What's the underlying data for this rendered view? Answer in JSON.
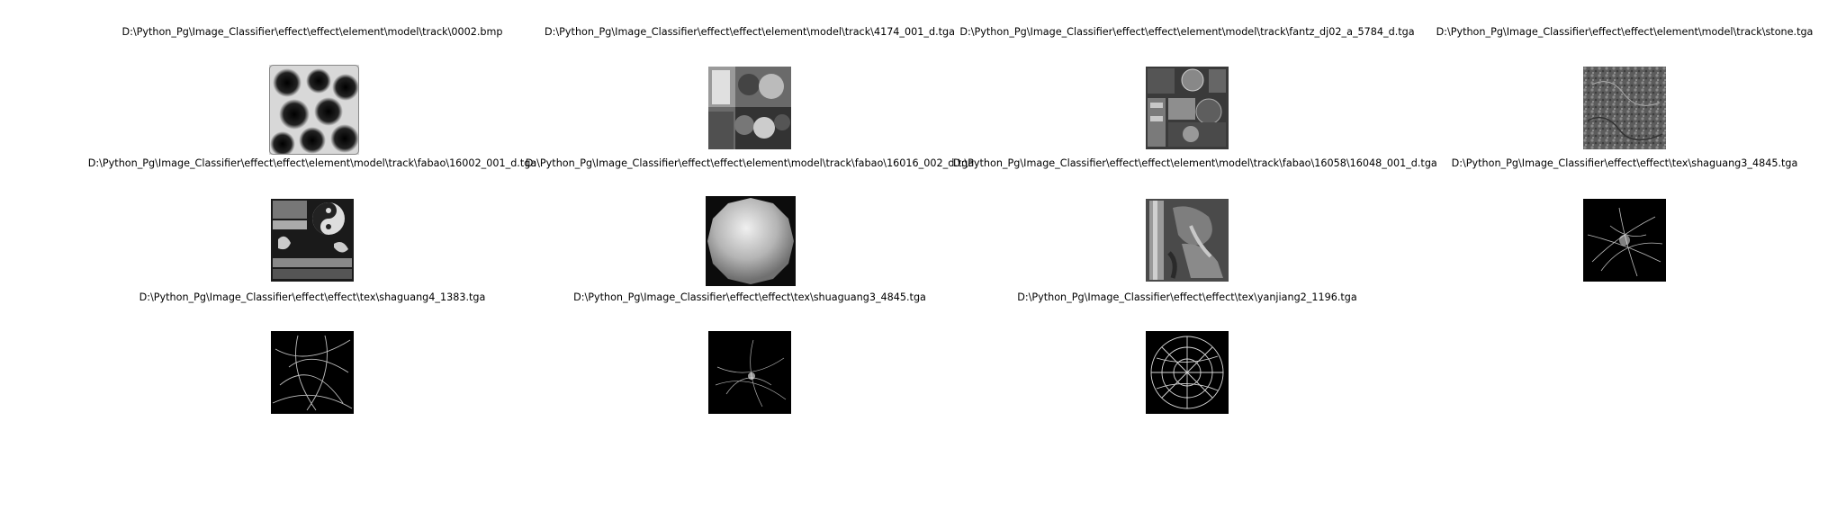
{
  "figure": {
    "tiles": [
      {
        "caption": "D:\\Python_Pg\\Image_Classifier\\effect\\effect\\element\\model\\track\\0002.bmp",
        "thumbnail": "caustics-noise-texture"
      },
      {
        "caption": "D:\\Python_Pg\\Image_Classifier\\effect\\effect\\element\\model\\track\\4174_001_d.tga",
        "thumbnail": "costume-atlas-texture"
      },
      {
        "caption": "D:\\Python_Pg\\Image_Classifier\\effect\\effect\\element\\model\\track\\fantz_dj02_a_5784_d.tga",
        "thumbnail": "ornament-atlas-texture"
      },
      {
        "caption": "D:\\Python_Pg\\Image_Classifier\\effect\\effect\\element\\model\\track\\stone.tga",
        "thumbnail": "stone-texture"
      },
      {
        "caption": "D:\\Python_Pg\\Image_Classifier\\effect\\effect\\element\\model\\track\\fabao\\16002_001_d.tga",
        "thumbnail": "yin-yang-atlas-texture"
      },
      {
        "caption": "D:\\Python_Pg\\Image_Classifier\\effect\\effect\\element\\model\\track\\fabao\\16016_002_d.tga",
        "thumbnail": "metal-sphere-texture"
      },
      {
        "caption": "D:\\Python_Pg\\Image_Classifier\\effect\\effect\\element\\model\\track\\fabao\\16058\\16048_001_d.tga",
        "thumbnail": "weapon-atlas-texture"
      },
      {
        "caption": "D:\\Python_Pg\\Image_Classifier\\effect\\effect\\tex\\shaguang3_4845.tga",
        "thumbnail": "light-streak-texture"
      },
      {
        "caption": "D:\\Python_Pg\\Image_Classifier\\effect\\effect\\tex\\shaguang4_1383.tga",
        "thumbnail": "light-streak-texture"
      },
      {
        "caption": "D:\\Python_Pg\\Image_Classifier\\effect\\effect\\tex\\shuaguang3_4845.tga",
        "thumbnail": "light-streak-texture"
      },
      {
        "caption": "D:\\Python_Pg\\Image_Classifier\\effect\\effect\\tex\\yanjiang2_1196.tga",
        "thumbnail": "lava-crack-texture"
      }
    ]
  }
}
